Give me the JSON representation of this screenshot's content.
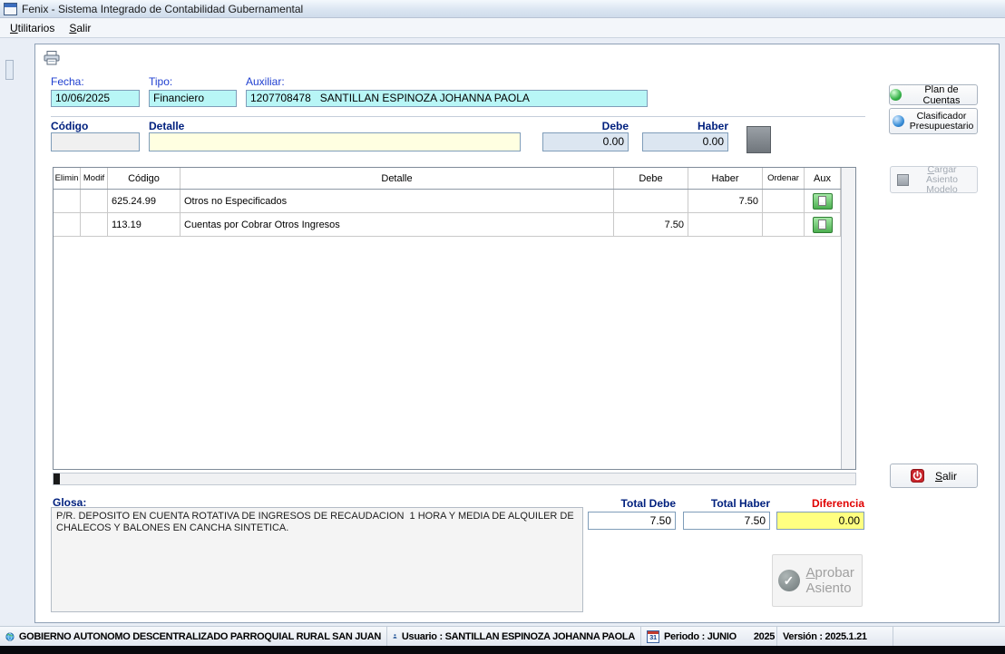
{
  "window": {
    "title": "Fenix - Sistema Integrado de Contabilidad Gubernamental",
    "menu": {
      "utilitarios": "Utilitarios",
      "salir": "Salir"
    }
  },
  "header_fields": {
    "fecha_label": "Fecha:",
    "fecha_value": "10/06/2025",
    "tipo_label": "Tipo:",
    "tipo_value": "Financiero",
    "auxiliar_label": "Auxiliar:",
    "auxiliar_value": "1207708478   SANTILLAN ESPINOZA JOHANNA PAOLA"
  },
  "entry_row": {
    "codigo_label": "Código",
    "codigo_value": "",
    "detalle_label": "Detalle",
    "detalle_value": "",
    "debe_label": "Debe",
    "debe_value": "0.00",
    "haber_label": "Haber",
    "haber_value": "0.00"
  },
  "side_buttons": {
    "plan_de_cuentas": "Plan de Cuentas",
    "clasificador": "Clasificador Presupuestario",
    "cargar_asiento_modelo": "Cargar Asiento Modelo",
    "salir": "Salir",
    "aprobar_asiento": "Aprobar Asiento"
  },
  "grid": {
    "headers": [
      "Elimin",
      "Modif",
      "Código",
      "Detalle",
      "Debe",
      "Haber",
      "Ordenar",
      "Aux"
    ],
    "rows": [
      {
        "codigo": "625.24.99",
        "detalle": "Otros no Especificados",
        "debe": "",
        "haber": "7.50"
      },
      {
        "codigo": "113.19",
        "detalle": "Cuentas por Cobrar Otros Ingresos",
        "debe": "7.50",
        "haber": ""
      }
    ]
  },
  "glosa": {
    "label": "Glosa:",
    "text": "P/R. DEPOSITO EN CUENTA ROTATIVA DE INGRESOS DE RECAUDACION  1 HORA Y MEDIA DE ALQUILER DE CHALECOS Y BALONES EN CANCHA SINTETICA."
  },
  "totals": {
    "debe_label": "Total Debe",
    "debe": "7.50",
    "haber_label": "Total Haber",
    "haber": "7.50",
    "diferencia_label": "Diferencia",
    "diferencia": "0.00"
  },
  "statusbar": {
    "entidad": "GOBIERNO AUTONOMO DESCENTRALIZADO PARROQUIAL RURAL SAN JUAN",
    "usuario": "Usuario : SANTILLAN ESPINOZA JOHANNA PAOLA",
    "periodo": "Periodo : JUNIO",
    "anio": "2025",
    "version": "Versión : 2025.1.21",
    "calendar_day": "31"
  },
  "colors": {
    "cyan_field": "#b8f6f6",
    "yellow_field": "#ffffe1",
    "debe_haber_field": "#dce6f1",
    "diferencia_bg": "#ffff80",
    "diferencia_label": "#e00000",
    "label_blue": "#1f3fd0",
    "label_navy": "#00207e",
    "aux_button_green": "#4caf50"
  }
}
